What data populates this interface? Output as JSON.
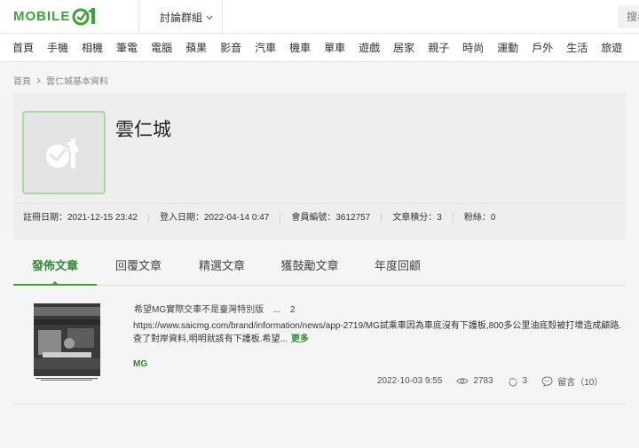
{
  "header": {
    "logo_text": "MOBILE",
    "group_menu_label": "討論群組",
    "search_placeholder": "搜尋"
  },
  "categories": [
    "首頁",
    "手機",
    "相機",
    "筆電",
    "電腦",
    "蘋果",
    "影音",
    "汽車",
    "機車",
    "單車",
    "遊戲",
    "居家",
    "親子",
    "時尚",
    "運動",
    "戶外",
    "生活",
    "旅遊"
  ],
  "breadcrumb": {
    "home": "首頁",
    "current": "雲仁城基本資料"
  },
  "profile": {
    "name": "雲仁城",
    "register_date": "註冊日期：2021-12-15 23:42",
    "login_date": "登入日期：2022-04-14 0:47",
    "member_id": "會員編號：3612757",
    "article_points": "文章積分：3",
    "fans": "粉絲：0"
  },
  "tabs": [
    "發佈文章",
    "回覆文章",
    "精選文章",
    "獲鼓勵文章",
    "年度回顧"
  ],
  "post": {
    "title": "希望MG實際交車不是臺灣特別版",
    "ellipsis": "...",
    "page_count": "2",
    "excerpt": "https://www.saicmg.com/brand/information/news/app-2719/MG試乘車因為車底沒有下護板,800多公里油底殼被打壞造成顧路.查了對岸資料,明明就該有下護板.希望...",
    "more_label": "更多",
    "tag": "MG",
    "date": "2022-10-03 9:55",
    "views": "2783",
    "likes": "3",
    "comments": "留言（10）"
  },
  "colors": {
    "brand_green": "#3ea33a",
    "link_green": "#2e8b2e"
  }
}
